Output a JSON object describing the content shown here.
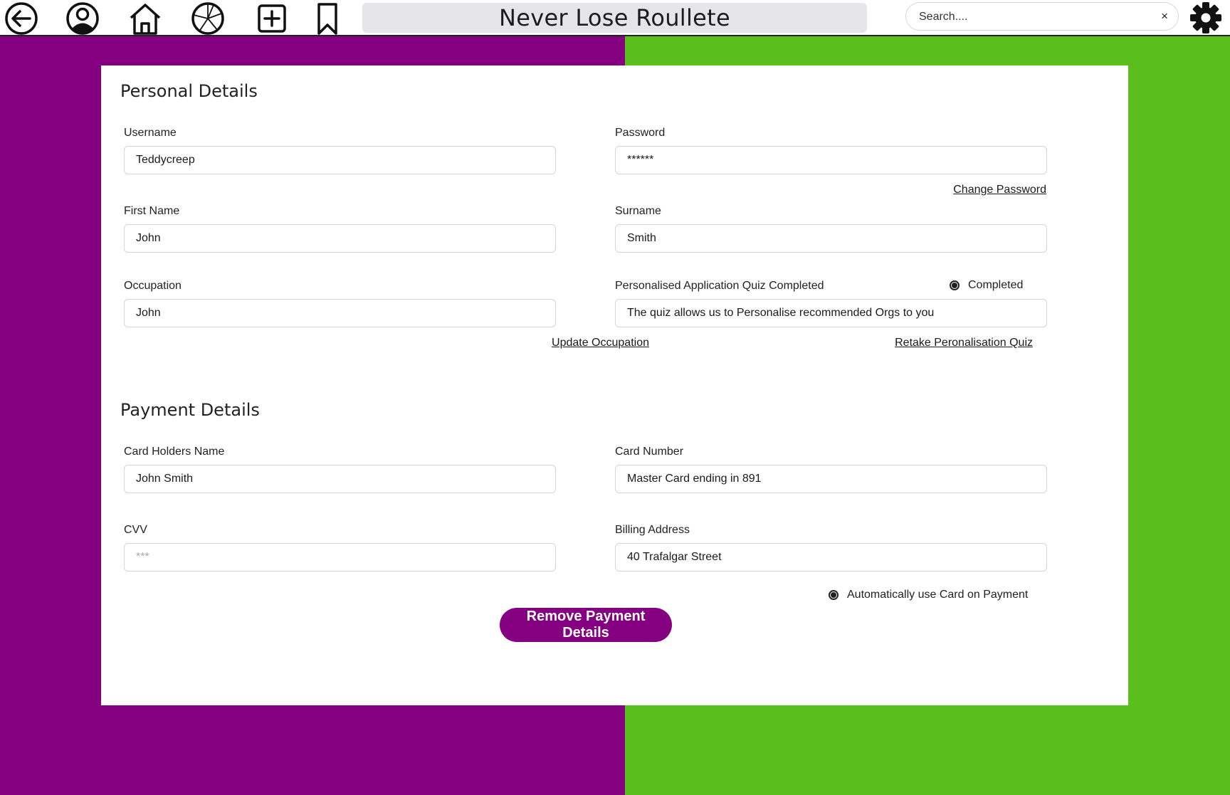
{
  "app": {
    "title": "Never Lose Roullete"
  },
  "colors": {
    "purple": "#850080",
    "green": "#5abe1d",
    "button_bg": "#850080"
  },
  "nav": {
    "icons": [
      "back-icon",
      "profile-icon",
      "home-icon",
      "roulette-wheel-icon",
      "add-icon",
      "bookmark-icon"
    ],
    "settings_icon": "gear-icon"
  },
  "search": {
    "placeholder": "Search....",
    "clear_label": "×"
  },
  "personal": {
    "title": "Personal Details",
    "username": {
      "label": "Username",
      "value": "Teddycreep"
    },
    "password": {
      "label": "Password",
      "value": "******"
    },
    "change_password_link": "Change Password",
    "first_name": {
      "label": "First Name",
      "value": "John"
    },
    "surname": {
      "label": "Surname",
      "value": "Smith"
    },
    "occupation": {
      "label": "Occupation",
      "value": "John"
    },
    "update_occupation_link": "Update Occupation",
    "quiz": {
      "label": "Personalised Application Quiz Completed",
      "status_label": "Completed",
      "status_checked": true,
      "value": "The quiz allows us to Personalise recommended Orgs to you"
    },
    "retake_quiz_link": "Retake Peronalisation Quiz"
  },
  "payment": {
    "title": "Payment Details",
    "card_holder": {
      "label": "Card Holders Name",
      "value": "John Smith"
    },
    "card_number": {
      "label": "Card Number",
      "value": "Master Card ending in 891"
    },
    "cvv": {
      "label": "CVV",
      "placeholder": "***"
    },
    "billing_address": {
      "label": "Billing Address",
      "value": "40 Trafalgar Street"
    },
    "auto_use": {
      "label": "Automatically use Card on Payment",
      "checked": true
    },
    "remove_button": "Remove Payment Details"
  }
}
